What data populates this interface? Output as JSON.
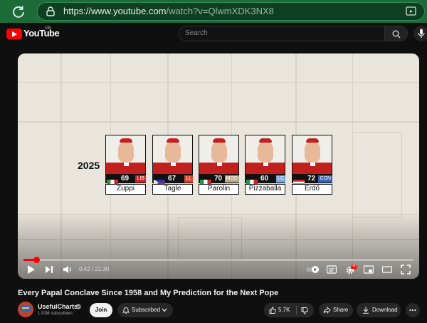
{
  "browser": {
    "url_host": "https://www.youtube.com",
    "url_path": "/watch?v=QlwmXDK3NX8"
  },
  "header": {
    "logo_text": "YouTube",
    "region": "GB",
    "search_placeholder": "Search"
  },
  "video": {
    "year_label": "2025",
    "candidates": [
      {
        "name": "Zuppi",
        "age": "69",
        "tag": "LIB",
        "tag_color": "#c8252b",
        "flag": "italy"
      },
      {
        "name": "Tagle",
        "age": "67",
        "tag": "LL",
        "tag_color": "#d9452f",
        "flag": "philippines"
      },
      {
        "name": "Parolin",
        "age": "70",
        "tag": "MOD",
        "tag_color": "#b9a98c",
        "flag": "italy"
      },
      {
        "name": "Pizzaballa",
        "age": "60",
        "tag": "LC",
        "tag_color": "#7aa7d4",
        "flag": "italy"
      },
      {
        "name": "Erdő",
        "age": "72",
        "tag": "CON",
        "tag_color": "#3b63b5",
        "flag": "hungary"
      }
    ]
  },
  "player": {
    "current_time": "0:42",
    "duration": "21:30",
    "progress_fraction": 0.033,
    "hd_badge": "HD"
  },
  "info": {
    "title": "Every Papal Conclave Since 1958 and My Prediction for the Next Pope",
    "channel_name": "UsefulCharts",
    "subscribers": "1.91M subscribers",
    "join_label": "Join",
    "subscribed_label": "Subscribed",
    "like_count": "5.7K",
    "share_label": "Share",
    "download_label": "Download"
  },
  "colors": {
    "browser_bar": "#1e6b3a",
    "accent_red": "#ff0000",
    "background": "#0f0f0f"
  }
}
